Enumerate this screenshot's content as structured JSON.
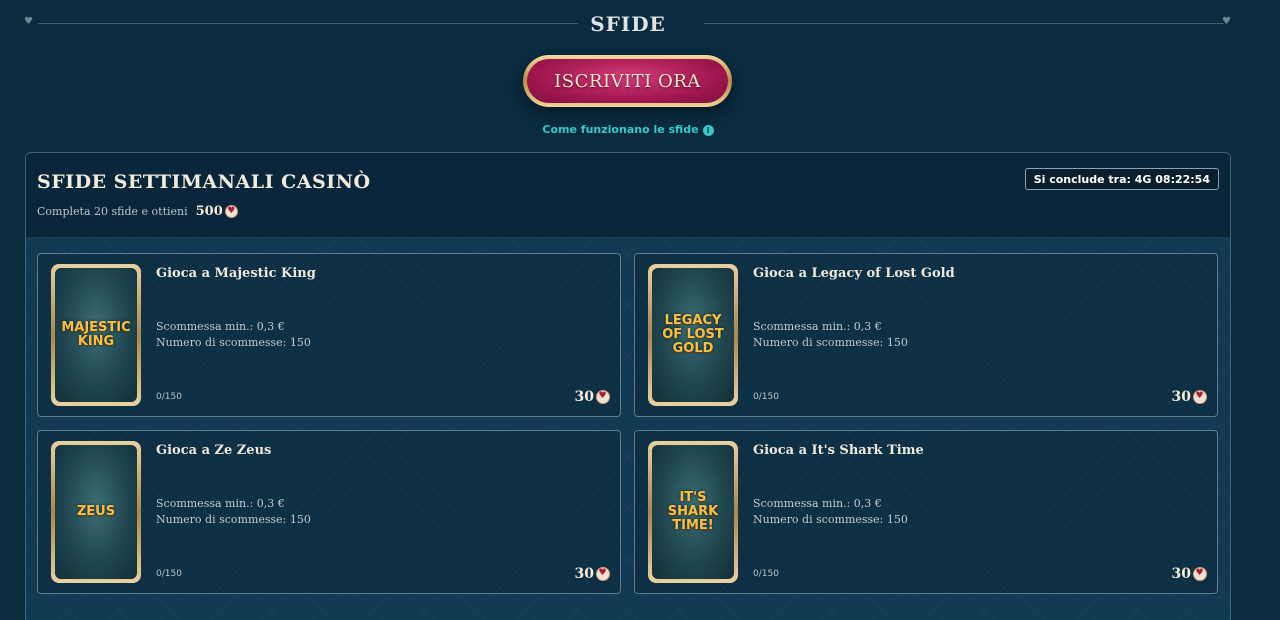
{
  "header": {
    "title": "SFIDE",
    "cta_label": "ISCRIVITI ORA",
    "how_link": "Come funzionano le sfide"
  },
  "panel": {
    "title": "SFIDE SETTIMANALI CASINÒ",
    "subtitle": "Completa 20 sfide e ottieni",
    "reward": "500",
    "countdown": "Si conclude tra: 4G 08:22:54"
  },
  "cards": [
    {
      "title": "Gioca a Majestic King",
      "min_bet": "Scommessa min.: 0,3 €",
      "bet_count": "Numero di scommesse: 150",
      "progress": "0/150",
      "reward": "30",
      "art_text": "MAJESTIC KING"
    },
    {
      "title": "Gioca a Legacy of Lost Gold",
      "min_bet": "Scommessa min.: 0,3 €",
      "bet_count": "Numero di scommesse: 150",
      "progress": "0/150",
      "reward": "30",
      "art_text": "LEGACY OF LOST GOLD"
    },
    {
      "title": "Gioca a Ze Zeus",
      "min_bet": "Scommessa min.: 0,3 €",
      "bet_count": "Numero di scommesse: 150",
      "progress": "0/150",
      "reward": "30",
      "art_text": "ZEUS"
    },
    {
      "title": "Gioca a It's Shark Time",
      "min_bet": "Scommessa min.: 0,3 €",
      "bet_count": "Numero di scommesse: 150",
      "progress": "0/150",
      "reward": "30",
      "art_text": "IT'S SHARK TIME!"
    }
  ],
  "icons": {
    "coin": "heart-coin-icon",
    "info": "info-icon",
    "gem": "heart-gem-icon"
  },
  "colors": {
    "background": "#0b2b3f",
    "accent": "#35c9c9",
    "cta": "#a31852",
    "gold": "#e8d1a0"
  }
}
